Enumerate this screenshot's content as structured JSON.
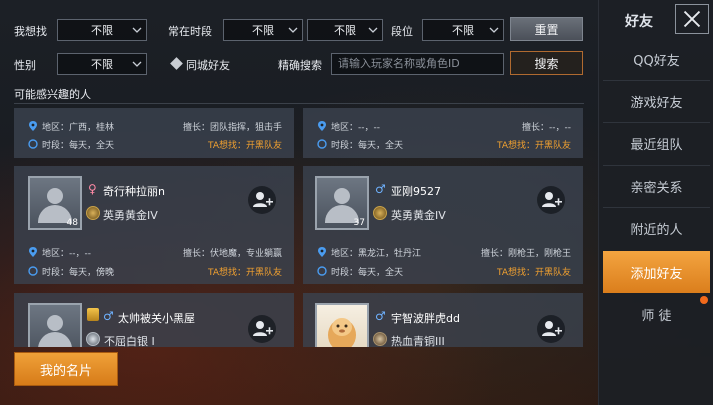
{
  "filters": {
    "find_label": "我想找",
    "find_value": "不限",
    "time_label": "常在时段",
    "time_value_1": "不限",
    "time_value_2": "不限",
    "rank_label": "段位",
    "rank_value": "不限",
    "reset_label": "重置",
    "gender_label": "性别",
    "gender_value": "不限",
    "same_city_label": "同城好友",
    "exact_search_label": "精确搜索",
    "search_placeholder": "请输入玩家名称或角色ID",
    "search_button": "搜索"
  },
  "section_title": "可能感兴趣的人",
  "cards": [
    {
      "region": "地区：广西，桂林",
      "skill": "擅长：团队指挥，狙击手",
      "time": "时段：每天，全天",
      "wants": "TA想找：开黑队友"
    },
    {
      "region": "地区：--，--",
      "skill": "擅长：--，--",
      "time": "时段：每天，全天",
      "wants": "TA想找：开黑队友"
    },
    {
      "name": "奇行种拉丽n",
      "gender": "♀",
      "level": "48",
      "rank": "英勇黄金IV",
      "region": "地区：--，--",
      "skill": "擅长：伏地魔，专业躺赢",
      "time": "时段：每天，傍晚",
      "wants": "TA想找：开黑队友"
    },
    {
      "name": "亚刚9527",
      "gender": "♂",
      "level": "37",
      "rank": "英勇黄金IV",
      "region": "地区：黑龙江，牡丹江",
      "skill": "擅长：刚枪王，刚枪王",
      "time": "时段：每天，全天",
      "wants": "TA想找：开黑队友"
    },
    {
      "name": "太帅被关小黑屋",
      "gender": "♂",
      "rank": "不屈白银 I"
    },
    {
      "name": "宇智波胖虎dd",
      "gender": "♂",
      "rank": "热血青铜III"
    }
  ],
  "my_card_button": "我的名片",
  "sidebar": {
    "title": "好友",
    "items": [
      {
        "label": "QQ好友"
      },
      {
        "label": "游戏好友"
      },
      {
        "label": "最近组队"
      },
      {
        "label": "亲密关系"
      },
      {
        "label": "附近的人"
      },
      {
        "label": "添加好友"
      },
      {
        "label": "师  徒"
      }
    ]
  },
  "colors": {
    "accent_orange": "#e8901f",
    "ta_text": "#f0a030",
    "female": "#ff8aa6",
    "male": "#6fb2ff"
  }
}
